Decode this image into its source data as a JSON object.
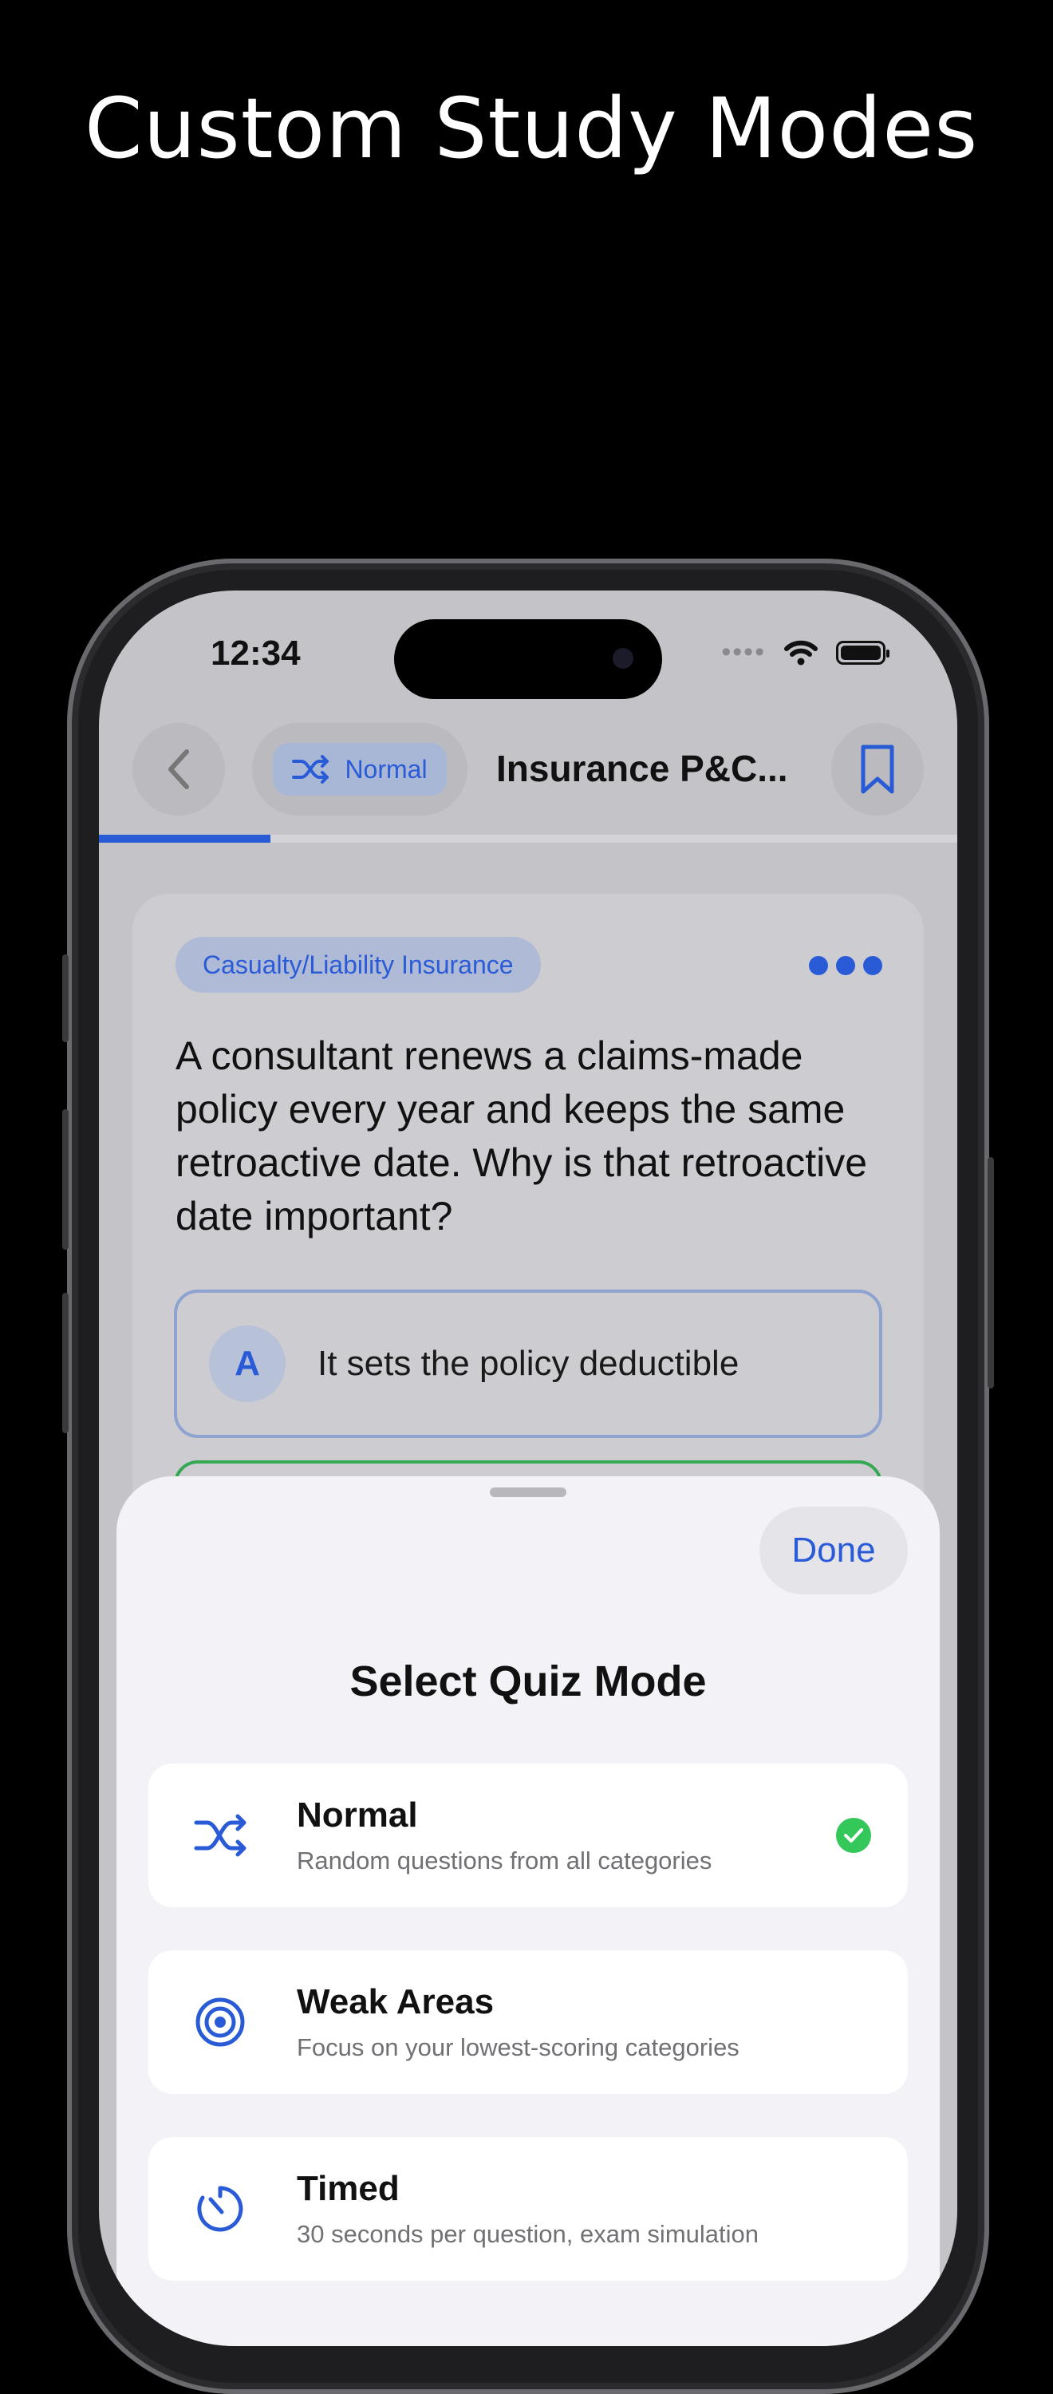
{
  "headline": "Custom Study Modes",
  "status": {
    "time": "12:34"
  },
  "nav": {
    "mode_label": "Normal",
    "title": "Insurance P&C...",
    "progress_fraction": 0.2
  },
  "question_card": {
    "category": "Casualty/Liability Insurance",
    "question": "A consultant renews a claims-made policy every year and keeps the same retroactive date. Why is that retroactive date important?",
    "answers": [
      {
        "letter": "A",
        "text": "It sets the policy deductible"
      }
    ]
  },
  "sheet": {
    "done_label": "Done",
    "title": "Select Quiz Mode",
    "modes": [
      {
        "name": "Normal",
        "description": "Random questions from all categories",
        "icon": "shuffle-icon",
        "selected": true
      },
      {
        "name": "Weak Areas",
        "description": "Focus on your lowest-scoring categories",
        "icon": "target-icon",
        "selected": false
      },
      {
        "name": "Timed",
        "description": "30 seconds per question, exam simulation",
        "icon": "timer-icon",
        "selected": false
      }
    ]
  },
  "colors": {
    "accent": "#2a5bd7",
    "correct": "#34a853",
    "check": "#34c759"
  }
}
